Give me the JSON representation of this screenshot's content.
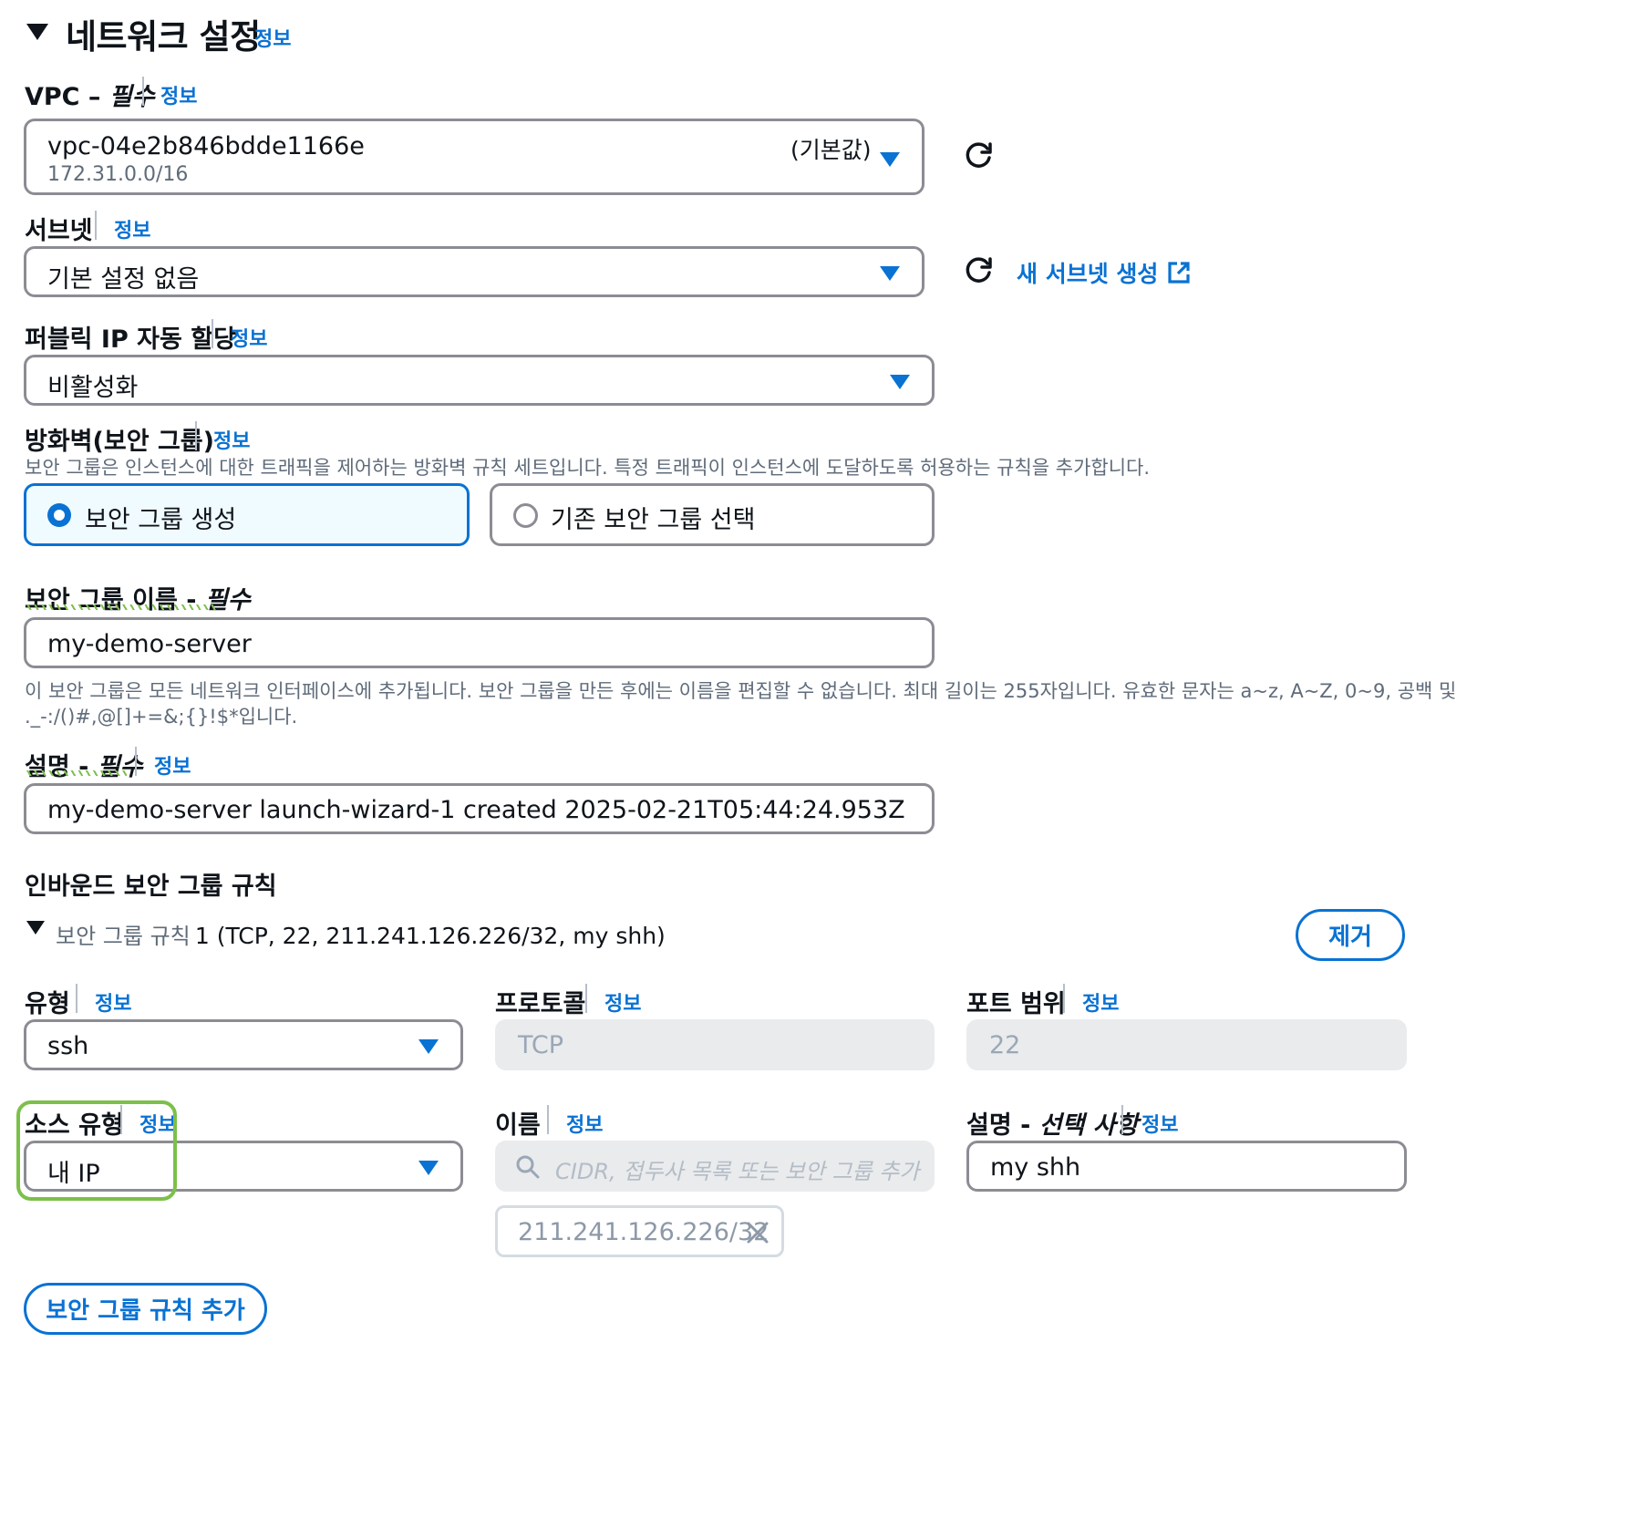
{
  "section": {
    "title": "네트워크 설정",
    "info": "정보"
  },
  "vpc": {
    "label": "VPC –",
    "required": "필수",
    "info": "정보",
    "value": "vpc-04e2b846bdde1166e",
    "cidr": "172.31.0.0/16",
    "tag": "(기본값)"
  },
  "subnet": {
    "label": "서브넷",
    "info": "정보",
    "value": "기본 설정 없음",
    "create_link": "새 서브넷 생성"
  },
  "public_ip": {
    "label": "퍼블릭 IP 자동 할당",
    "info": "정보",
    "value": "비활성화"
  },
  "firewall": {
    "label": "방화벽(보안 그룹)",
    "info": "정보",
    "description": "보안 그룹은 인스턴스에 대한 트래픽을 제어하는 방화벽 규칙 세트입니다. 특정 트래픽이 인스턴스에 도달하도록 허용하는 규칙을 추가합니다.",
    "option_create": "보안 그룹 생성",
    "option_existing": "기존 보안 그룹 선택"
  },
  "sg_name": {
    "label": "보안 그룹 이름 -",
    "required": "필수",
    "value": "my-demo-server",
    "help_line1": "이 보안 그룹은 모든 네트워크 인터페이스에 추가됩니다. 보안 그룹을 만든 후에는 이름을 편집할 수 없습니다. 최대 길이는 255자입니다. 유효한 문자는 a~z, A~Z, 0~9, 공백 및",
    "help_line2": "._-:/()#,@[]+=&;{}!$*입니다."
  },
  "sg_desc": {
    "label": "설명 -",
    "required": "필수",
    "info": "정보",
    "value": "my-demo-server launch-wizard-1 created 2025-02-21T05:44:24.953Z"
  },
  "inbound": {
    "title": "인바운드 보안 그룹 규칙",
    "rule_prefix": "보안 그룹 규칙",
    "rule_summary": "1 (TCP, 22, 211.241.126.226/32, my shh)",
    "remove_button": "제거",
    "type": {
      "label": "유형",
      "info": "정보",
      "value": "ssh"
    },
    "protocol": {
      "label": "프로토콜",
      "info": "정보",
      "value": "TCP"
    },
    "port": {
      "label": "포트 범위",
      "info": "정보",
      "value": "22"
    },
    "source_type": {
      "label": "소스 유형",
      "info": "정보",
      "value": "내 IP"
    },
    "name": {
      "label": "이름",
      "info": "정보",
      "placeholder": "CIDR, 접두사 목록 또는 보안 그룹 추가",
      "token": "211.241.126.226/32"
    },
    "rule_desc": {
      "label": "설명 -",
      "optional": "선택 사항",
      "info": "정보",
      "value": "my shh"
    },
    "add_button": "보안 그룹 규칙 추가"
  },
  "colors": {
    "accent": "#0972d3",
    "highlight": "#7cc04a",
    "border": "#8c8c94"
  }
}
